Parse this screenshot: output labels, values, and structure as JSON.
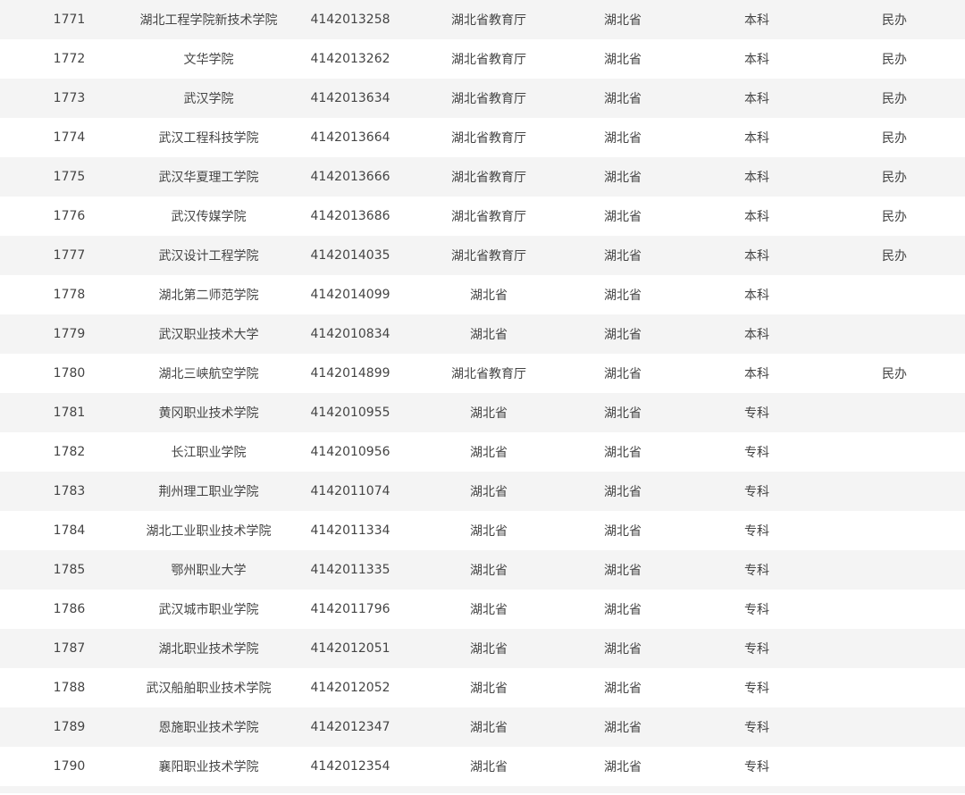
{
  "rows": [
    [
      "1771",
      "湖北工程学院新技术学院",
      "4142013258",
      "湖北省教育厅",
      "湖北省",
      "本科",
      "民办"
    ],
    [
      "1772",
      "文华学院",
      "4142013262",
      "湖北省教育厅",
      "湖北省",
      "本科",
      "民办"
    ],
    [
      "1773",
      "武汉学院",
      "4142013634",
      "湖北省教育厅",
      "湖北省",
      "本科",
      "民办"
    ],
    [
      "1774",
      "武汉工程科技学院",
      "4142013664",
      "湖北省教育厅",
      "湖北省",
      "本科",
      "民办"
    ],
    [
      "1775",
      "武汉华夏理工学院",
      "4142013666",
      "湖北省教育厅",
      "湖北省",
      "本科",
      "民办"
    ],
    [
      "1776",
      "武汉传媒学院",
      "4142013686",
      "湖北省教育厅",
      "湖北省",
      "本科",
      "民办"
    ],
    [
      "1777",
      "武汉设计工程学院",
      "4142014035",
      "湖北省教育厅",
      "湖北省",
      "本科",
      "民办"
    ],
    [
      "1778",
      "湖北第二师范学院",
      "4142014099",
      "湖北省",
      "湖北省",
      "本科",
      ""
    ],
    [
      "1779",
      "武汉职业技术大学",
      "4142010834",
      "湖北省",
      "湖北省",
      "本科",
      ""
    ],
    [
      "1780",
      "湖北三峡航空学院",
      "4142014899",
      "湖北省教育厅",
      "湖北省",
      "本科",
      "民办"
    ],
    [
      "1781",
      "黄冈职业技术学院",
      "4142010955",
      "湖北省",
      "湖北省",
      "专科",
      ""
    ],
    [
      "1782",
      "长江职业学院",
      "4142010956",
      "湖北省",
      "湖北省",
      "专科",
      ""
    ],
    [
      "1783",
      "荆州理工职业学院",
      "4142011074",
      "湖北省",
      "湖北省",
      "专科",
      ""
    ],
    [
      "1784",
      "湖北工业职业技术学院",
      "4142011334",
      "湖北省",
      "湖北省",
      "专科",
      ""
    ],
    [
      "1785",
      "鄂州职业大学",
      "4142011335",
      "湖北省",
      "湖北省",
      "专科",
      ""
    ],
    [
      "1786",
      "武汉城市职业学院",
      "4142011796",
      "湖北省",
      "湖北省",
      "专科",
      ""
    ],
    [
      "1787",
      "湖北职业技术学院",
      "4142012051",
      "湖北省",
      "湖北省",
      "专科",
      ""
    ],
    [
      "1788",
      "武汉船舶职业技术学院",
      "4142012052",
      "湖北省",
      "湖北省",
      "专科",
      ""
    ],
    [
      "1789",
      "恩施职业技术学院",
      "4142012347",
      "湖北省",
      "湖北省",
      "专科",
      ""
    ],
    [
      "1790",
      "襄阳职业技术学院",
      "4142012354",
      "湖北省",
      "湖北省",
      "专科",
      ""
    ]
  ]
}
